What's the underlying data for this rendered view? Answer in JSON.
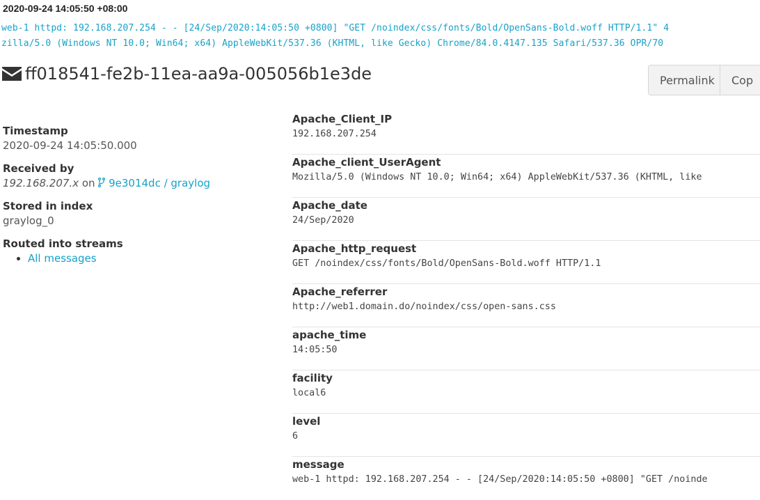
{
  "header": {
    "timestamp": "2020-09-24 14:05:50 +08:00",
    "log_line_1": "web-1 httpd: 192.168.207.254 - - [24/Sep/2020:14:05:50 +0800] \"GET /noindex/css/fonts/Bold/OpenSans-Bold.woff HTTP/1.1\" 4",
    "log_line_2": "zilla/5.0 (Windows NT 10.0; Win64; x64) AppleWebKit/537.36 (KHTML, like Gecko) Chrome/84.0.4147.135 Safari/537.36 OPR/70",
    "message_id": "ff018541-fe2b-11ea-aa9a-005056b1e3de",
    "message_icon": "envelope-icon"
  },
  "actions": {
    "permalink_label": "Permalink",
    "copy_label": "Cop"
  },
  "meta": {
    "timestamp_label": "Timestamp",
    "timestamp_value": "2020-09-24 14:05:50.000",
    "received_label": "Received by",
    "received_source": "192.168.207.x",
    "received_on": "on",
    "received_node": "9e3014dc / graylog",
    "received_node_icon": "code-fork-icon",
    "index_label": "Stored in index",
    "index_value": "graylog_0",
    "streams_label": "Routed into streams",
    "streams": [
      "All messages"
    ]
  },
  "fields": [
    {
      "name": "Apache_Client_IP",
      "value": "192.168.207.254"
    },
    {
      "name": "Apache_client_UserAgent",
      "value": "Mozilla/5.0 (Windows NT 10.0; Win64; x64) AppleWebKit/537.36 (KHTML, like"
    },
    {
      "name": "Apache_date",
      "value": "24/Sep/2020"
    },
    {
      "name": "Apache_http_request",
      "value": "GET /noindex/css/fonts/Bold/OpenSans-Bold.woff HTTP/1.1"
    },
    {
      "name": "Apache_referrer",
      "value": "http://web1.domain.do/noindex/css/open-sans.css"
    },
    {
      "name": "apache_time",
      "value": "14:05:50"
    },
    {
      "name": "facility",
      "value": "local6"
    },
    {
      "name": "level",
      "value": "6"
    },
    {
      "name": "message",
      "value": "web-1 httpd: 192.168.207.254 - - [24/Sep/2020:14:05:50 +0800] \"GET /noinde"
    }
  ],
  "colors": {
    "link": "#16a2c8",
    "text": "#333333"
  }
}
